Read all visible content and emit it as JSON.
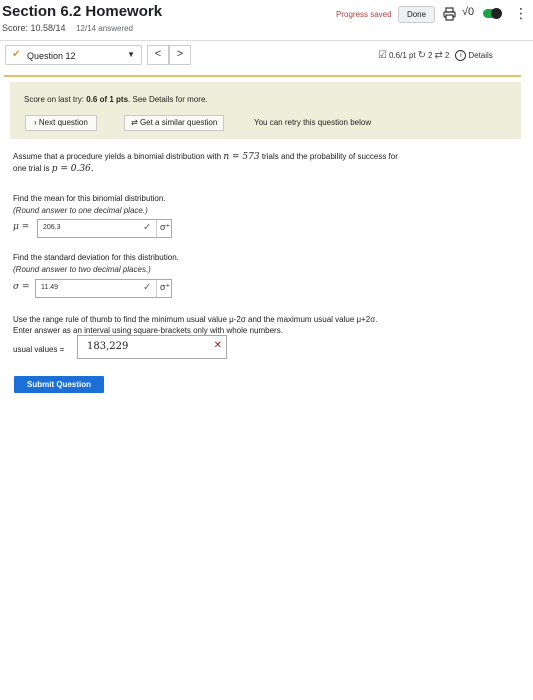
{
  "header": {
    "title": "Section 6.2 Homework",
    "score": "Score: 10.58/14",
    "answered": "12/14 answered",
    "progress_saved": "Progress saved",
    "done_label": "Done",
    "sqrt_label": "√0"
  },
  "question_nav": {
    "selected_question": "Question 12",
    "prev_label": "<",
    "next_label": ">",
    "points": "0.6/1 pt",
    "retries": "2",
    "attempts": "2",
    "details_label": "Details"
  },
  "feedback": {
    "score_prefix": "Score on last try: ",
    "score_value": "0.6 of 1 pts",
    "score_suffix": ". See Details for more.",
    "next_question_label": "Next question",
    "similar_question_label": "Get a similar question",
    "retry_text": "You can retry this question below"
  },
  "question": {
    "intro_a": "Assume that a procedure yields a binomial distribution with",
    "intro_n": "n = 573",
    "intro_b": "trials and the probability of success for",
    "intro_c": "one trial is",
    "intro_p": "p = 0.36.",
    "mean_prompt": "Find the mean for this binomial distribution.",
    "mean_instruction": "(Round answer to one decimal place.)",
    "mean_symbol": "μ =",
    "mean_answer": "206.3",
    "sd_prompt": "Find the standard deviation for this distribution.",
    "sd_instruction": "(Round answer to two decimal places.)",
    "sd_symbol": "σ =",
    "sd_answer": "11.49",
    "range_prompt_1": "Use the range rule of thumb to find the minimum usual value μ-2σ and the maximum usual value μ+2σ.",
    "range_prompt_2": "Enter answer as an interval using square-brackets only with whole numbers.",
    "usual_label": "usual values =",
    "usual_answer": "183,229",
    "submit_label": "Submit Question"
  }
}
